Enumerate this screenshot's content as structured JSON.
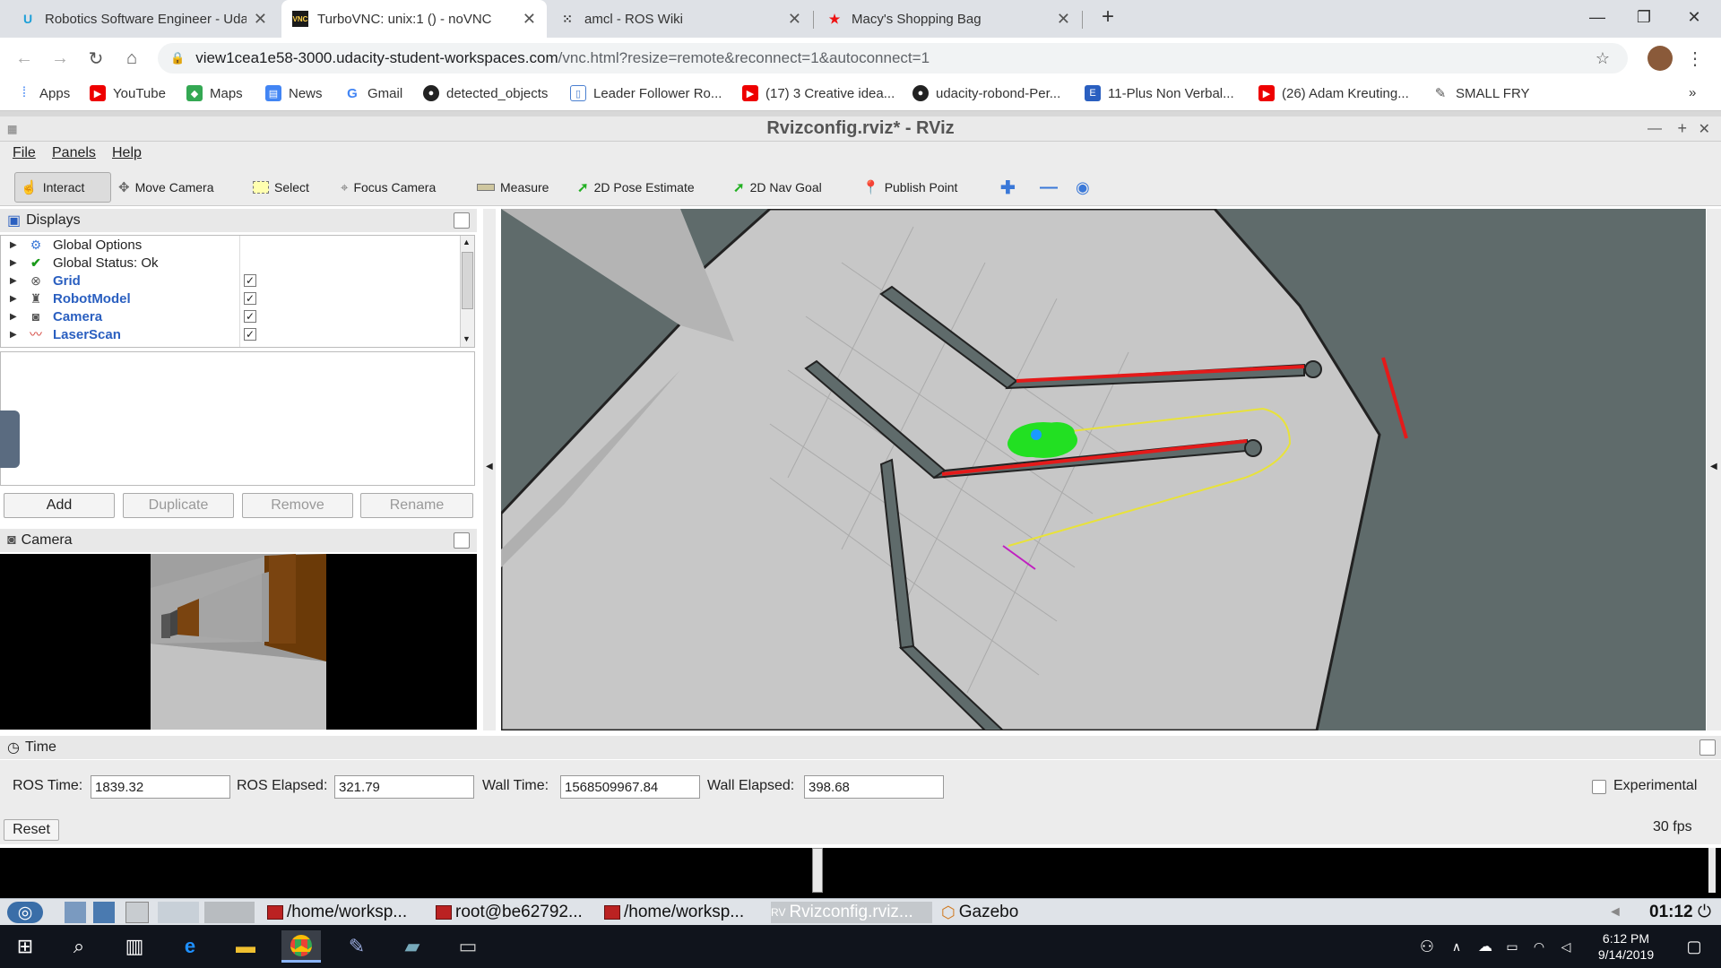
{
  "browser": {
    "tabs": [
      {
        "title": "Robotics Software Engineer - Uda",
        "icon": "udacity-icon",
        "active": false
      },
      {
        "title": "TurboVNC: unix:1 () - noVNC",
        "icon": "vnc-icon",
        "active": true
      },
      {
        "title": "amcl - ROS Wiki",
        "icon": "ros-icon",
        "active": false
      },
      {
        "title": "Macy's Shopping Bag",
        "icon": "macys-star-icon",
        "active": false
      }
    ],
    "url_host": "view1cea1e58-3000.udacity-student-workspaces.com",
    "url_path": "/vnc.html?resize=remote&reconnect=1&autoconnect=1",
    "bookmarks": [
      "Apps",
      "YouTube",
      "Maps",
      "News",
      "Gmail",
      "detected_objects",
      "Leader Follower Ro...",
      "(17) 3 Creative idea...",
      "udacity-robond-Per...",
      "11-Plus Non Verbal...",
      "(26) Adam Kreuting...",
      "SMALL FRY"
    ],
    "more_bookmarks": "»"
  },
  "rviz": {
    "window_title": "Rvizconfig.rviz* - RViz",
    "menu": [
      "File",
      "Panels",
      "Help"
    ],
    "tools": [
      "Interact",
      "Move Camera",
      "Select",
      "Focus Camera",
      "Measure",
      "2D Pose Estimate",
      "2D Nav Goal",
      "Publish Point"
    ],
    "displays_header": "Displays",
    "displays": [
      {
        "label": "Global Options",
        "checked": null
      },
      {
        "label": "Global Status: Ok",
        "checked": null
      },
      {
        "label": "Grid",
        "checked": true
      },
      {
        "label": "RobotModel",
        "checked": true
      },
      {
        "label": "Camera",
        "checked": true
      },
      {
        "label": "LaserScan",
        "checked": true
      }
    ],
    "check_mark": "✓",
    "buttons": [
      "Add",
      "Duplicate",
      "Remove",
      "Rename"
    ],
    "camera_header": "Camera",
    "time_header": "Time",
    "time": {
      "ros_time_label": "ROS Time:",
      "ros_time": "1839.32",
      "ros_elapsed_label": "ROS Elapsed:",
      "ros_elapsed": "321.79",
      "wall_time_label": "Wall Time:",
      "wall_time": "1568509967.84",
      "wall_elapsed_label": "Wall Elapsed:",
      "wall_elapsed": "398.68",
      "experimental_label": "Experimental",
      "reset_label": "Reset",
      "fps": "30 fps"
    }
  },
  "vnc_taskbar": {
    "tasks": [
      "/home/worksp...",
      "root@be62792...",
      "/home/worksp...",
      "Rvizconfig.rviz...",
      "Gazebo"
    ],
    "clock": "01:12"
  },
  "windows": {
    "time": "6:12 PM",
    "date": "9/14/2019"
  }
}
